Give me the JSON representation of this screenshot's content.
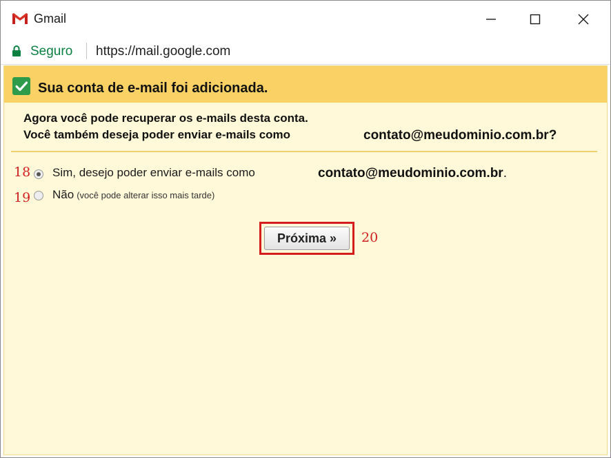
{
  "window": {
    "title": "Gmail",
    "icons": {
      "app": "gmail-logo",
      "minimize": "minimize-icon",
      "maximize": "maximize-icon",
      "close": "close-icon"
    }
  },
  "address_bar": {
    "secure_label": "Seguro",
    "url": "https://mail.google.com",
    "icon": "lock-icon"
  },
  "banner": {
    "icon": "check-icon",
    "text": "Sua conta de e-mail foi adicionada."
  },
  "message": {
    "line1": "Agora você pode recuperar os e-mails desta conta.",
    "line2": "Você também deseja poder enviar e-mails como",
    "email": "contato@meudominio.com.br",
    "email_suffix": "?"
  },
  "options": {
    "yes": {
      "label": "Sim, desejo poder enviar e-mails como",
      "email": "contato@meudominio.com.br",
      "suffix": ".",
      "checked": true
    },
    "no": {
      "label": "Não",
      "note": "(você pode alterar isso mais tarde)",
      "checked": false
    }
  },
  "next_button": {
    "label": "Próxima »"
  },
  "annotations": {
    "a18": "18",
    "a19": "19",
    "a20": "20"
  },
  "colors": {
    "banner": "#fad165",
    "content_bg": "#fff8d9",
    "secure_green": "#0b8043",
    "annotation_red": "#d22020",
    "gmail_red": "#d93025"
  }
}
